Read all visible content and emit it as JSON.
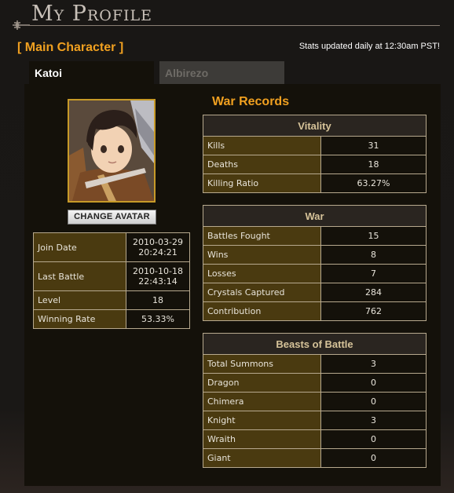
{
  "header": {
    "title": "My Profile"
  },
  "main_character_label": "[ Main Character ]",
  "stats_note": "Stats updated daily at 12:30am PST!",
  "tabs": [
    {
      "label": "Katoi",
      "active": true
    },
    {
      "label": "Albirezo",
      "active": false
    }
  ],
  "avatar": {
    "change_label": "CHANGE AVATAR"
  },
  "info": [
    {
      "label": "Join Date",
      "value_line1": "2010-03-29",
      "value_line2": "20:24:21"
    },
    {
      "label": "Last Battle",
      "value_line1": "2010-10-18",
      "value_line2": "22:43:14"
    },
    {
      "label": "Level",
      "value_line1": "18",
      "value_line2": ""
    },
    {
      "label": "Winning Rate",
      "value_line1": "53.33%",
      "value_line2": ""
    }
  ],
  "war_records_title": "War Records",
  "vitality": {
    "title": "Vitality",
    "rows": [
      {
        "label": "Kills",
        "value": "31"
      },
      {
        "label": "Deaths",
        "value": "18"
      },
      {
        "label": "Killing Ratio",
        "value": "63.27%"
      }
    ]
  },
  "war": {
    "title": "War",
    "rows": [
      {
        "label": "Battles Fought",
        "value": "15"
      },
      {
        "label": "Wins",
        "value": "8"
      },
      {
        "label": "Losses",
        "value": "7"
      },
      {
        "label": "Crystals Captured",
        "value": "284"
      },
      {
        "label": "Contribution",
        "value": "762"
      }
    ]
  },
  "beasts": {
    "title": "Beasts of Battle",
    "rows": [
      {
        "label": "Total Summons",
        "value": "3"
      },
      {
        "label": "Dragon",
        "value": "0"
      },
      {
        "label": "Chimera",
        "value": "0"
      },
      {
        "label": "Knight",
        "value": "3"
      },
      {
        "label": "Wraith",
        "value": "0"
      },
      {
        "label": "Giant",
        "value": "0"
      }
    ]
  },
  "colors": {
    "accent": "#f0a020",
    "label_cell": "#4a3a10",
    "border": "#b7a98e",
    "panel": "#14110a"
  }
}
